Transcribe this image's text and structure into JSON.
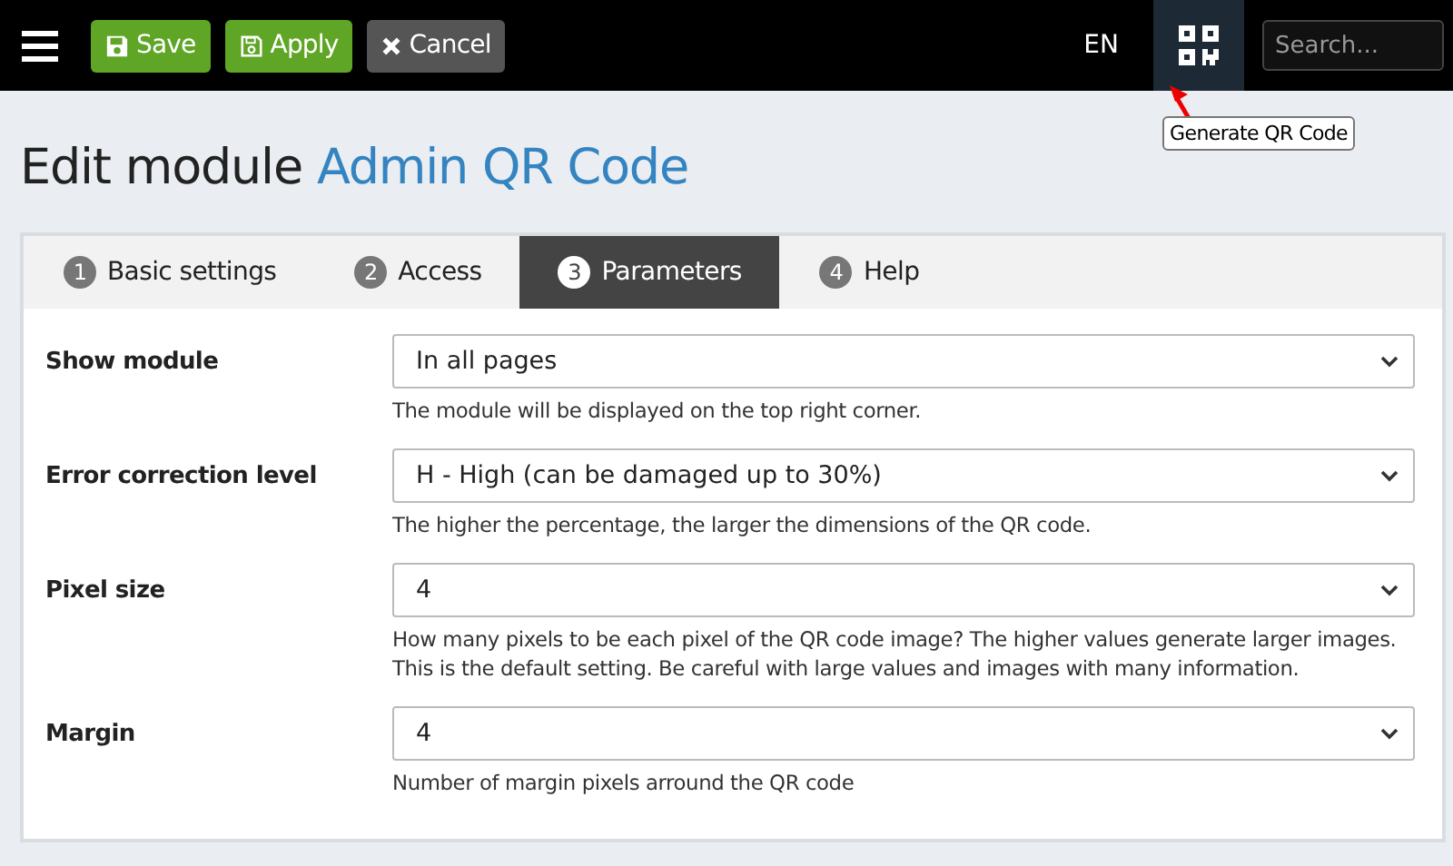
{
  "toolbar": {
    "buttons": [
      {
        "label": "Save",
        "kind": "save"
      },
      {
        "label": "Apply",
        "kind": "apply"
      },
      {
        "label": "Cancel",
        "kind": "cancel"
      }
    ],
    "language": "EN",
    "qr_tooltip": "Generate QR Code",
    "search": {
      "placeholder": "Search..."
    }
  },
  "heading": {
    "prefix": "Edit module",
    "name": "Admin QR Code"
  },
  "tabs": [
    {
      "number": "1",
      "label": "Basic settings",
      "selected": false
    },
    {
      "number": "2",
      "label": "Access",
      "selected": false
    },
    {
      "number": "3",
      "label": "Parameters",
      "selected": true
    },
    {
      "number": "4",
      "label": "Help",
      "selected": false
    }
  ],
  "fields": [
    {
      "label": "Show module",
      "value": "In all pages",
      "help": "The module will be displayed on the top right corner."
    },
    {
      "label": "Error correction level",
      "value": "H - High (can be damaged up to 30%)",
      "help": "The higher the percentage, the larger the dimensions of the QR code."
    },
    {
      "label": "Pixel size",
      "value": "4",
      "help": "How many pixels to be each pixel of the QR code image? The higher values generate larger images. This is the default setting. Be careful with large values and images with many information."
    },
    {
      "label": "Margin",
      "value": "4",
      "help": "Number of margin pixels arround the QR code"
    }
  ]
}
